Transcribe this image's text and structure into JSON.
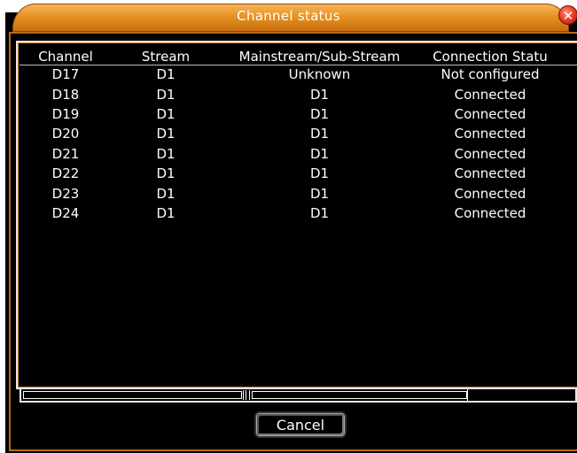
{
  "window": {
    "title": "Channel status",
    "close_label": "✕"
  },
  "table": {
    "headers": [
      "Channel",
      "Stream",
      "Mainstream/Sub-Stream",
      "Connection Statu"
    ],
    "rows": [
      [
        "D17",
        "D1",
        "Unknown",
        "Not configured"
      ],
      [
        "D18",
        "D1",
        "D1",
        "Connected"
      ],
      [
        "D19",
        "D1",
        "D1",
        "Connected"
      ],
      [
        "D20",
        "D1",
        "D1",
        "Connected"
      ],
      [
        "D21",
        "D1",
        "D1",
        "Connected"
      ],
      [
        "D22",
        "D1",
        "D1",
        "Connected"
      ],
      [
        "D23",
        "D1",
        "D1",
        "Connected"
      ],
      [
        "D24",
        "D1",
        "D1",
        "Connected"
      ]
    ]
  },
  "footer": {
    "cancel_label": "Cancel"
  },
  "colors": {
    "accent_orange": "#e79224",
    "background": "#000000",
    "text": "#ffffff",
    "close_red": "#e8331c"
  }
}
